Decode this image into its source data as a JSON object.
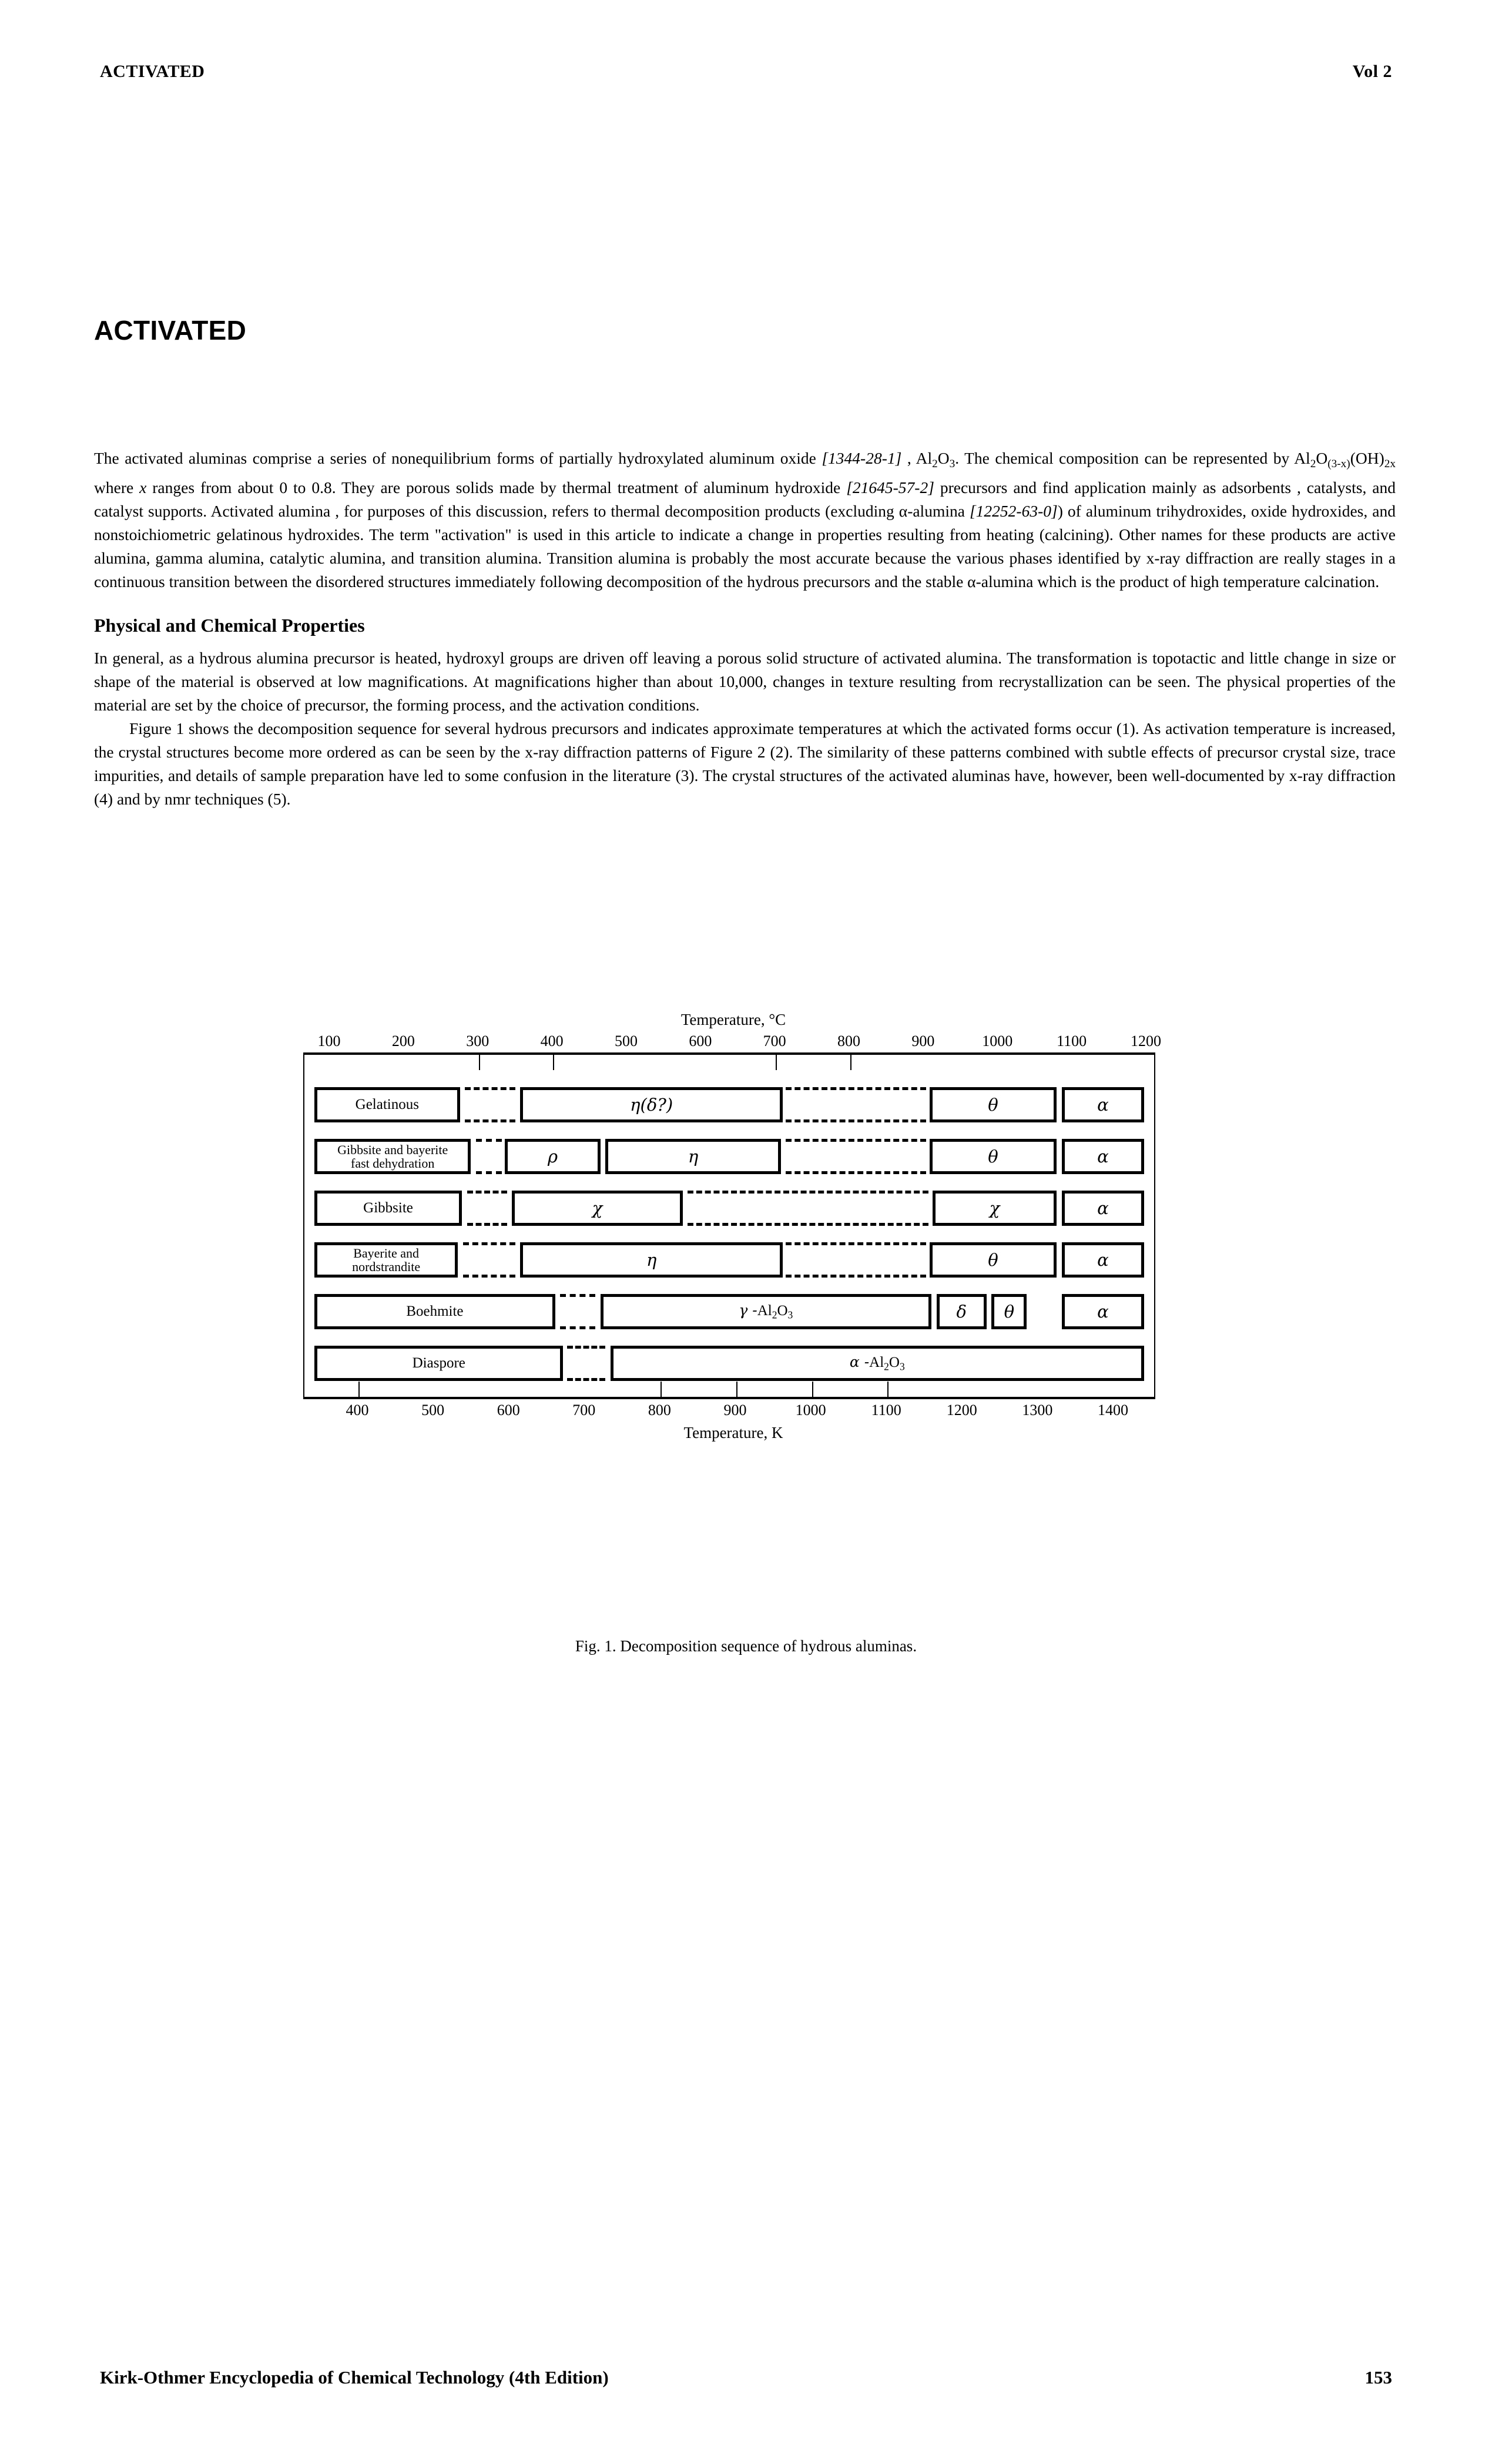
{
  "header": {
    "left": "ACTIVATED",
    "right": "Vol 2"
  },
  "title": "ACTIVATED",
  "paragraphs": {
    "p1_a": "The activated aluminas comprise a series of nonequilibrium forms of partially hydroxylated  aluminum oxide ",
    "p1_cas1": "[1344-28-1]",
    "p1_b": " , Al",
    "p1_c": ". The chemical composition can be represented by Al",
    "p1_d": "(OH)",
    "p1_e": " where ",
    "p1_x": "x",
    "p1_f": " ranges from about 0 to 0.8. They are porous solids made by thermal treatment of  aluminum hydroxide ",
    "p1_cas2": "[21645-57-2]",
    "p1_g": " precursors and find application mainly as adsorbents , catalysts, and catalyst supports. Activated alumina , for purposes of this discussion, refers to thermal decomposition products (excluding  α-alumina ",
    "p1_cas3": "[12252-63-0]",
    "p1_h": ") of aluminum trihydroxides, oxide hydroxides, and nonstoichiometric gelatinous hydroxides. The term \"activation\" is used in this article to indicate a change in properties resulting from heating (calcining). Other names for these products are active alumina, gamma alumina, catalytic alumina, and transition alumina. Transition alumina is probably the most accurate because the various phases identified by x-ray diffraction are really stages in a continuous transition between the disordered structures immediately following decomposition of the hydrous precursors and the stable  α-alumina which is the product of high temperature calcination."
  },
  "section_heading": "Physical and Chemical Properties",
  "paragraph2": "In general, as a hydrous alumina precursor is heated, hydroxyl groups are driven off leaving a porous solid structure of activated alumina. The transformation is topotactic and little change in size or shape of the material is observed at low magnifications. At magnifications higher than about 10,000, changes in texture resulting from recrystallization can be seen. The physical properties of the material are set by the choice of precursor, the forming process, and the activation conditions.",
  "paragraph3": "Figure 1 shows the decomposition sequence for several hydrous precursors and indicates approximate temperatures at which the activated forms occur (1). As activation temperature is increased, the crystal structures become more ordered as can be seen by the x-ray diffraction patterns of Figure  2 (2). The similarity of these patterns combined with subtle effects of precursor crystal size, trace impurities, and details of sample preparation have led to some confusion in the literature (3). The crystal structures of the activated aluminas have, however, been well-documented by x-ray diffraction  (4) and by nmr techniques (5).",
  "figure": {
    "caption": "Fig. 1. Decomposition sequence of hydrous aluminas.",
    "top_axis_label": "Temperature, °C",
    "bottom_axis_label": "Temperature, K",
    "top_ticks": [
      "100",
      "200",
      "300",
      "400",
      "500",
      "600",
      "700",
      "800",
      "900",
      "1000",
      "1100",
      "1200"
    ],
    "bottom_ticks": [
      "400",
      "500",
      "600",
      "700",
      "800",
      "900",
      "1000",
      "1100",
      "1200",
      "1300",
      "1400"
    ],
    "rows": [
      {
        "name": "Gelatinous",
        "segments": [
          {
            "text": "Gelatinous",
            "kind": "solid"
          },
          {
            "text": "",
            "kind": "dash"
          },
          {
            "text": "η(δ?)",
            "kind": "solid",
            "greek": true
          },
          {
            "text": "",
            "kind": "dash"
          },
          {
            "text": "θ",
            "kind": "solid",
            "greek": true
          },
          {
            "text": "α",
            "kind": "solid",
            "greek": true
          }
        ]
      },
      {
        "name": "Gibbsite and bayerite fast dehydration",
        "segments": [
          {
            "text": "Gibbsite and bayerite\nfast dehydration",
            "kind": "solid"
          },
          {
            "text": "",
            "kind": "dash"
          },
          {
            "text": "ρ",
            "kind": "solid",
            "greek": true
          },
          {
            "text": "η",
            "kind": "solid",
            "greek": true
          },
          {
            "text": "",
            "kind": "dash"
          },
          {
            "text": "θ",
            "kind": "solid",
            "greek": true
          },
          {
            "text": "α",
            "kind": "solid",
            "greek": true
          }
        ]
      },
      {
        "name": "Gibbsite",
        "segments": [
          {
            "text": "Gibbsite",
            "kind": "solid"
          },
          {
            "text": "",
            "kind": "dash"
          },
          {
            "text": "χ",
            "kind": "solid",
            "greek": true
          },
          {
            "text": "",
            "kind": "dash"
          },
          {
            "text": "χ",
            "kind": "solid",
            "greek": true
          },
          {
            "text": "α",
            "kind": "solid",
            "greek": true
          }
        ]
      },
      {
        "name": "Bayerite and nordstrandite",
        "segments": [
          {
            "text": "Bayerite and\nnordstrandite",
            "kind": "solid"
          },
          {
            "text": "",
            "kind": "dash"
          },
          {
            "text": "η",
            "kind": "solid",
            "greek": true
          },
          {
            "text": "",
            "kind": "dash"
          },
          {
            "text": "θ",
            "kind": "solid",
            "greek": true
          },
          {
            "text": "α",
            "kind": "solid",
            "greek": true
          }
        ]
      },
      {
        "name": "Boehmite",
        "segments": [
          {
            "text": "Boehmite",
            "kind": "solid"
          },
          {
            "text": "",
            "kind": "dash"
          },
          {
            "text": "γ -Al2O3",
            "kind": "solid"
          },
          {
            "text": "δ",
            "kind": "solid",
            "greek": true
          },
          {
            "text": "θ",
            "kind": "solid",
            "greek": true
          },
          {
            "text": "α",
            "kind": "solid",
            "greek": true
          }
        ]
      },
      {
        "name": "Diaspore",
        "segments": [
          {
            "text": "Diaspore",
            "kind": "solid"
          },
          {
            "text": "",
            "kind": "dash"
          },
          {
            "text": "α -Al2O3",
            "kind": "solid"
          }
        ]
      }
    ]
  },
  "footer": {
    "left": "Kirk-Othmer Encyclopedia of Chemical Technology (4th Edition)",
    "right": "153"
  }
}
